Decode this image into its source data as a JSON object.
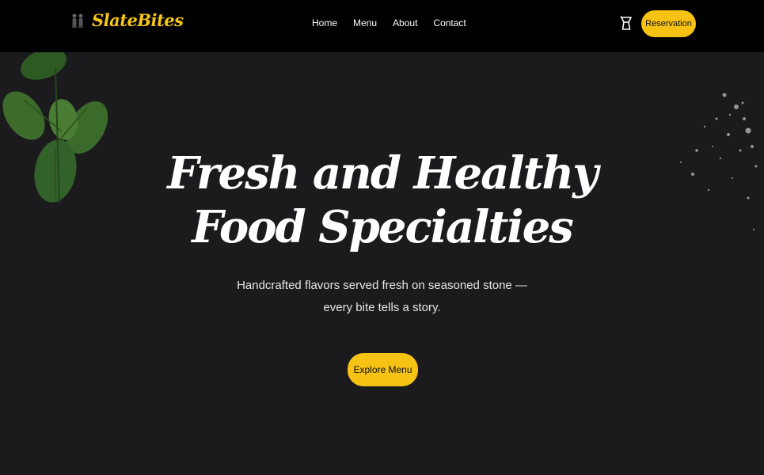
{
  "brand": {
    "name": "SlateBites",
    "logo_icon": "chef-figures-icon",
    "accent": "#f5c518"
  },
  "nav": {
    "links": [
      {
        "label": "Home"
      },
      {
        "label": "Menu"
      },
      {
        "label": "About"
      },
      {
        "label": "Contact"
      }
    ],
    "cart_icon": "cart-icon",
    "reservation_label": "Reservation"
  },
  "hero": {
    "title_line1": "Fresh and Healthy",
    "title_line2": "Food Specialties",
    "subtitle": "Handcrafted flavors served fresh on seasoned stone — every bite tells a story.",
    "cta_label": "Explore Menu"
  },
  "colors": {
    "background": "#1b1b1d",
    "navbar": "#000000",
    "button": "#f6c214"
  }
}
